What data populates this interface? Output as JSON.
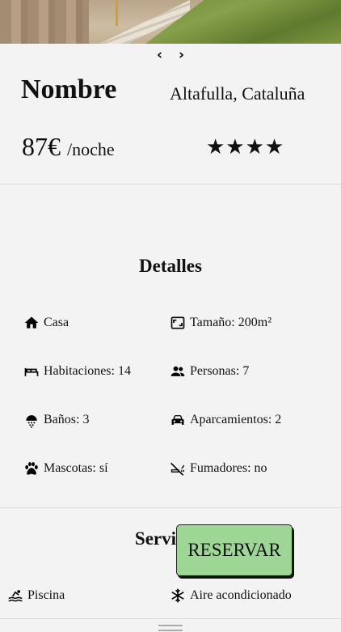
{
  "listing": {
    "name": "Nombre",
    "location": "Altafulla, Cataluña",
    "price": "87€",
    "price_unit": "/noche",
    "stars": "★★★★",
    "rating": 4
  },
  "carousel": {
    "prev": "‹",
    "next": "›"
  },
  "details": {
    "title": "Detalles",
    "items": {
      "type": "Casa",
      "size": "Tamaño: 200m²",
      "rooms": "Habitaciones: 14",
      "people": "Personas: 7",
      "baths": "Baños: 3",
      "parking": "Aparcamientos: 2",
      "pets": "Mascotas: sí",
      "smokers": "Fumadores: no"
    }
  },
  "services": {
    "title": "Servicios",
    "items": {
      "pool": "Piscina",
      "ac": "Aire acondicionado"
    }
  },
  "actions": {
    "reserve": "RESERVAR"
  },
  "colors": {
    "background": "#f3f3f3",
    "reserve_button": "#9ed795",
    "divider": "#d8d8d8"
  }
}
